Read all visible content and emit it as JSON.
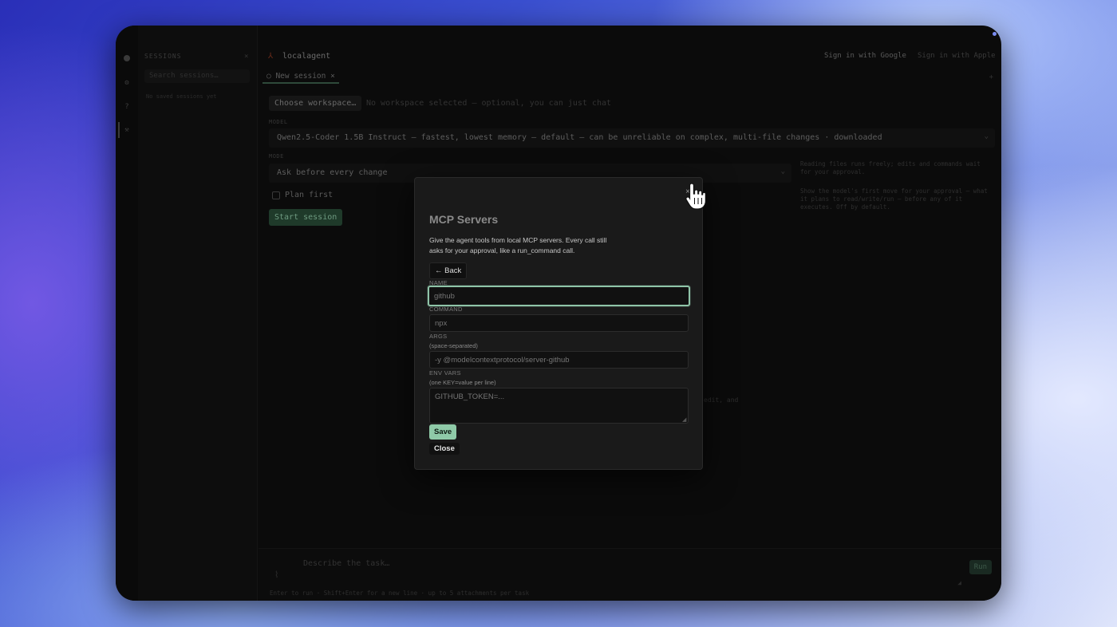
{
  "sidebar": {
    "title": "SESSIONS",
    "search_placeholder": "Search sessions…",
    "empty_text": "No saved sessions yet"
  },
  "header": {
    "app_name": "localagent",
    "sign_in_google": "Sign in with Google",
    "sign_in_apple": "Sign in with Apple"
  },
  "tabs": [
    {
      "label": "○ New session ×"
    }
  ],
  "workspace": {
    "button_label": "Choose workspace…",
    "hint": "No workspace selected — optional, you can just chat"
  },
  "model": {
    "label": "MODEL",
    "value": "Qwen2.5-Coder 1.5B Instruct — fastest, lowest memory — default — can be unreliable on complex, multi-file changes · downloaded"
  },
  "mode": {
    "label": "MODE",
    "value": "Ask before every change",
    "note": "Reading files runs freely; edits and commands wait for your approval."
  },
  "plan_first": {
    "label": "Plan first",
    "note": "Show the model's first move for your approval — what it plans to read/write/run — before any of it executes. Off by default."
  },
  "start_button": "Start session",
  "stray_text": "edit, and",
  "composer": {
    "placeholder": "Describe the task…",
    "run_label": "Run",
    "hint": "Enter to run · Shift+Enter for a new line · up to 5 attachments per task"
  },
  "modal": {
    "close_glyph": "×",
    "title": "MCP Servers",
    "description": "Give the agent tools from local MCP servers. Every call still asks for your approval, like a run_command call.",
    "back_label": "← Back",
    "fields": {
      "name_label": "NAME",
      "name_placeholder": "github",
      "command_label": "COMMAND",
      "command_placeholder": "npx",
      "args_label": "ARGS",
      "args_sub": "(space-separated)",
      "args_placeholder": "-y @modelcontextprotocol/server-github",
      "env_label": "ENV VARS",
      "env_sub": "(one KEY=value per line)",
      "env_placeholder": "GITHUB_TOKEN=..."
    },
    "save_label": "Save",
    "close_label": "Close"
  },
  "colors": {
    "accent": "#8fcaa8",
    "focus_ring": "#8fc4a8",
    "modal_bg": "#1a1a1a",
    "window_bg": "#0b0b0b"
  }
}
